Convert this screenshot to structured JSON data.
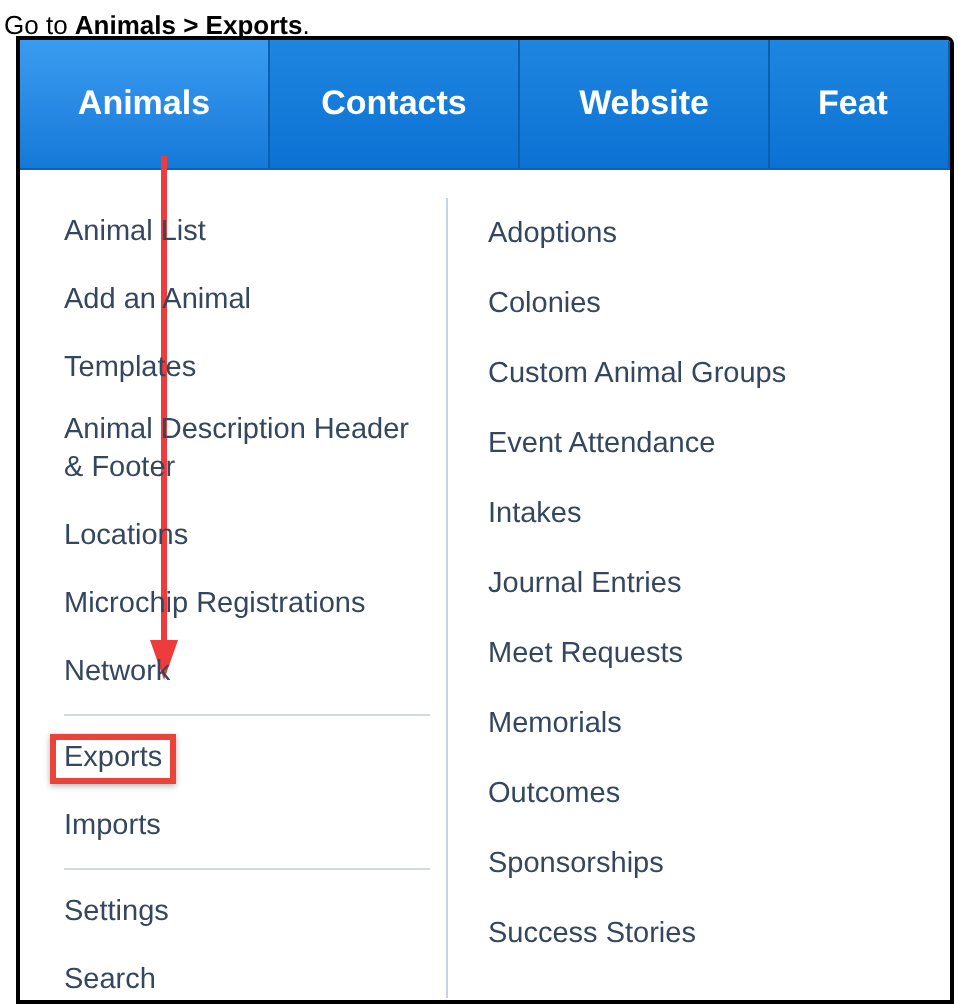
{
  "instruction": "Go to **Animals > Exports**.",
  "nav_tabs": [
    {
      "label": "Animals",
      "selected": true
    },
    {
      "label": "Contacts",
      "selected": false
    },
    {
      "label": "Website",
      "selected": false
    },
    {
      "label": "Feat",
      "selected": false
    }
  ],
  "menu": {
    "left_groups": [
      [
        {
          "label": "Animal List",
          "highlighted": false
        },
        {
          "label": "Add an Animal",
          "highlighted": false
        },
        {
          "label": "Templates",
          "highlighted": false
        },
        {
          "label": "Animal Description Header & Footer",
          "highlighted": false
        },
        {
          "label": "Locations",
          "highlighted": false
        },
        {
          "label": "Microchip Registrations",
          "highlighted": false
        },
        {
          "label": "Network",
          "highlighted": false
        }
      ],
      [
        {
          "label": "Exports",
          "highlighted": true
        },
        {
          "label": "Imports",
          "highlighted": false
        }
      ],
      [
        {
          "label": "Settings",
          "highlighted": false
        },
        {
          "label": "Search",
          "highlighted": false
        }
      ]
    ],
    "right_items": [
      {
        "label": "Adoptions"
      },
      {
        "label": "Colonies"
      },
      {
        "label": "Custom Animal Groups"
      },
      {
        "label": "Event Attendance"
      },
      {
        "label": "Intakes"
      },
      {
        "label": "Journal Entries"
      },
      {
        "label": "Meet Requests"
      },
      {
        "label": "Memorials"
      },
      {
        "label": "Outcomes"
      },
      {
        "label": "Sponsorships"
      },
      {
        "label": "Success Stories"
      }
    ]
  }
}
